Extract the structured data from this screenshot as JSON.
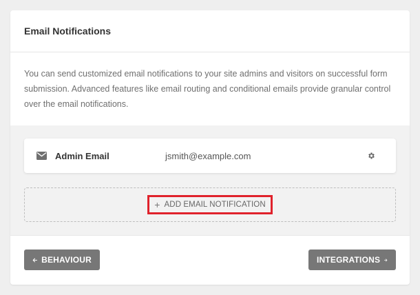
{
  "panel": {
    "title": "Email Notifications",
    "description": "You can send customized email notifications to your site admins and visitors on successful form submission. Advanced features like email routing and conditional emails provide granular control over the email notifications."
  },
  "notifications": [
    {
      "name": "Admin Email",
      "email": "jsmith@example.com",
      "icon": "envelope-icon"
    }
  ],
  "add_button": {
    "plus": "+",
    "label": "ADD EMAIL NOTIFICATION",
    "highlight_color": "#e0222b"
  },
  "footer": {
    "back_label": "BEHAVIOUR",
    "next_label": "INTEGRATIONS",
    "button_color": "#777777"
  }
}
